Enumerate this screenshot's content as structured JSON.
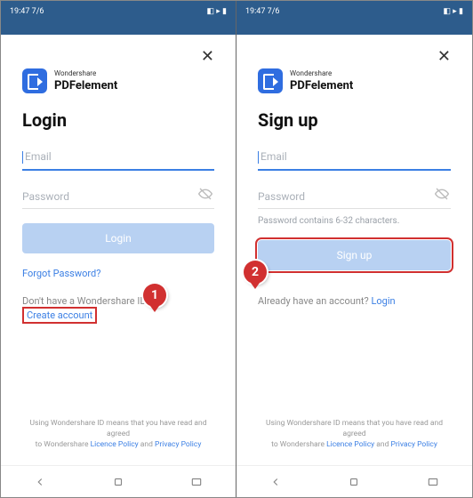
{
  "status": {
    "time": "19:47 7/6",
    "battery": "59"
  },
  "brand": {
    "top": "Wondershare",
    "bottom": "PDFelement"
  },
  "left": {
    "title": "Login",
    "emailPlaceholder": "Email",
    "passwordPlaceholder": "Password",
    "button": "Login",
    "forgot": "Forgot Password?",
    "noAccount": "Don't have a Wondershare ID?",
    "create": "Create account",
    "callout": "1"
  },
  "right": {
    "title": "Sign up",
    "emailPlaceholder": "Email",
    "passwordPlaceholder": "Password",
    "hint": "Password contains 6-32 characters.",
    "button": "Sign up",
    "already": "Already have an account?",
    "loginLink": "Login",
    "callout": "2"
  },
  "footer": {
    "line1": "Using Wondershare ID means that you have read and agreed",
    "line2a": "to Wondershare ",
    "licence": "Licence Policy",
    "and": " and ",
    "privacy": "Privacy Policy"
  },
  "close": "✕"
}
